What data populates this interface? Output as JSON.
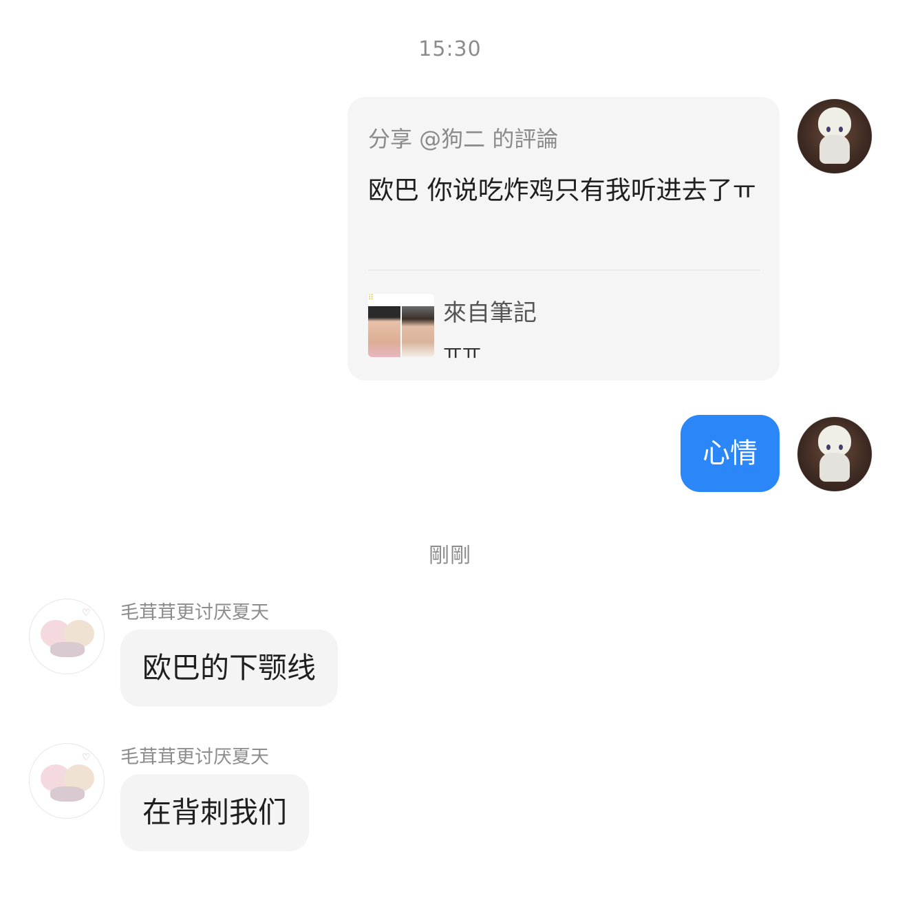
{
  "timestamps": {
    "first": "15:30",
    "second": "剛剛"
  },
  "messages": {
    "shared_comment": {
      "header": "分享 @狗二 的評論",
      "text": "欧巴 你说吃炸鸡只有我听进去了ㅠ",
      "note_from_label": "來自筆記",
      "note_text": "ㅠㅠ"
    },
    "self_message": {
      "text": "心情"
    },
    "other_messages": [
      {
        "sender": "毛茸茸更讨厌夏天",
        "text": "欧巴的下颚线"
      },
      {
        "sender": "毛茸茸更讨厌夏天",
        "text": "在背刺我们"
      }
    ]
  },
  "colors": {
    "self_bubble": "#2b86f7",
    "other_bubble": "#f4f4f4",
    "card_background": "#f5f5f5",
    "timestamp_text": "#8c8c8c"
  },
  "icons": {
    "self_avatar": "figurine-avatar",
    "other_avatar": "cartoon-cats-avatar"
  }
}
